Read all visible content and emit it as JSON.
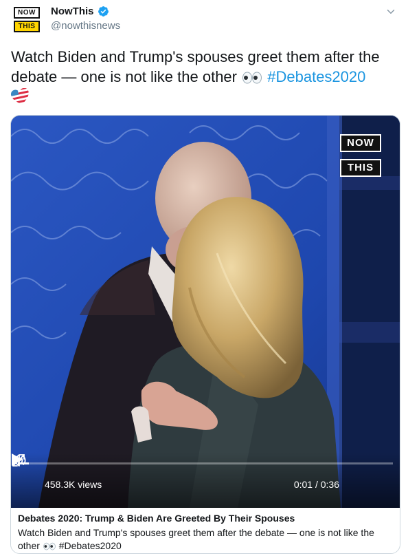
{
  "author": {
    "display_name": "NowThis",
    "handle": "@nowthisnews",
    "logo_top": "NOW",
    "logo_bottom": "THIS",
    "verified_icon": "verified-badge-icon",
    "verified_color": "#1da1f2"
  },
  "tweet": {
    "text": "Watch Biden and Trump's spouses greet them after the debate — one is not like the other",
    "hashtag": "#Debates2020",
    "hashtag_color": "#1b95e0"
  },
  "video": {
    "watermark_top": "NOW",
    "watermark_bottom": "THIS",
    "views": "458.3K views",
    "time": "0:01 / 0:36",
    "progress": 0.03,
    "play_icon": "play-icon",
    "volume_icon": "volume-icon",
    "fullscreen_icon": "fullscreen-icon"
  },
  "card": {
    "title": "Debates 2020: Trump & Biden Are Greeted By Their Spouses",
    "description": "Watch Biden and Trump's spouses greet them after the debate — one is not like the other",
    "hashtag": "#Debates2020"
  }
}
